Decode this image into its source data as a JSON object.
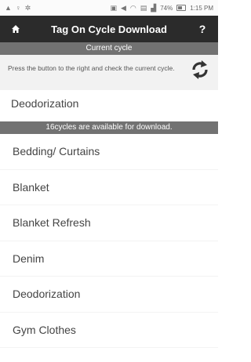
{
  "status_bar": {
    "battery": "74%",
    "time": "1:15 PM"
  },
  "header": {
    "title": "Tag On Cycle Download",
    "help": "?"
  },
  "current_cycle": {
    "section_title": "Current cycle",
    "instruction": "Press the button to the right and check the current cycle.",
    "value": "Deodorization"
  },
  "available": {
    "section_title": "16cycles are available for download."
  },
  "cycles": [
    {
      "label": "Bedding/ Curtains"
    },
    {
      "label": "Blanket"
    },
    {
      "label": "Blanket Refresh"
    },
    {
      "label": "Denim"
    },
    {
      "label": "Deodorization"
    },
    {
      "label": "Gym Clothes"
    }
  ],
  "icons": {
    "home": "home-icon",
    "refresh": "refresh-icon",
    "help": "help-icon"
  }
}
